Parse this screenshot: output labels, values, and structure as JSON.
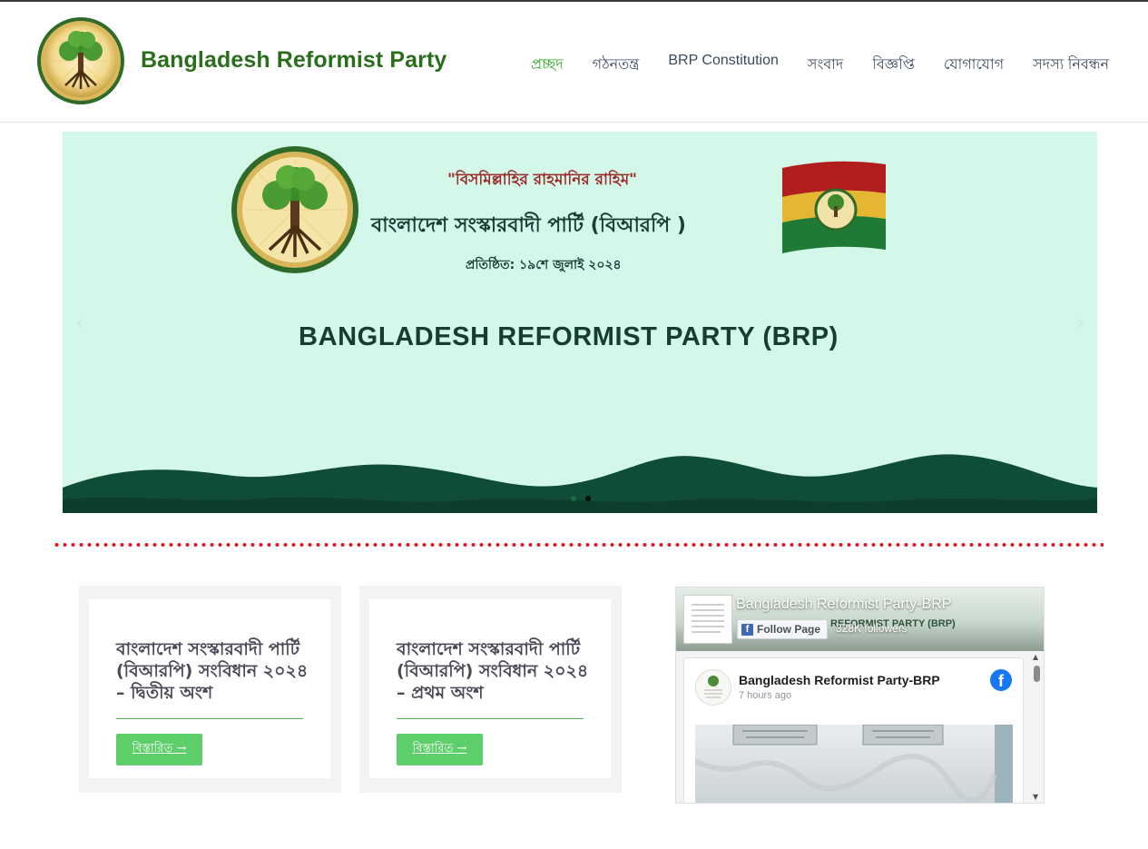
{
  "header": {
    "site_title": "Bangladesh Reformist Party",
    "nav": [
      {
        "label": "প্রচ্ছদ",
        "active": true
      },
      {
        "label": "গঠনতন্ত্র",
        "active": false
      },
      {
        "label": "BRP Constitution",
        "active": false
      },
      {
        "label": "সংবাদ",
        "active": false
      },
      {
        "label": "বিজ্ঞপ্তি",
        "active": false
      },
      {
        "label": "যোগাযোগ",
        "active": false
      },
      {
        "label": "সদস্য নিবন্ধন",
        "active": false
      }
    ]
  },
  "slider": {
    "bismillah": "\"বিসমিল্লাহির রাহমানির রাহিম\"",
    "party_name_bn": "বাংলাদেশ সংস্কারবাদী পার্টি (বিআরপি )",
    "founded": "প্রতিষ্ঠিত: ১৯শে জুলাই ২০২৪",
    "party_name_en": "BANGLADESH REFORMIST PARTY (BRP)",
    "prev_icon": "chevron-left-icon",
    "next_icon": "chevron-right-icon",
    "active_slide": 2,
    "slide_count": 2
  },
  "cards": [
    {
      "title": "বাংলাদেশ সংস্কারবাদী পার্টি (বিআরপি) সংবিধান ২০২৪ – দ্বিতীয় অংশ",
      "button": "বিস্তারিত →"
    },
    {
      "title": "বাংলাদেশ সংস্কারবাদী পার্টি (বিআরপি) সংবিধান ২০২৪ – প্রথম অংশ",
      "button": "বিস্তারিত →"
    }
  ],
  "facebook": {
    "page_name": "Bangladesh Reformist Party-BRP",
    "follow_label": "Follow Page",
    "followers": "328K followers",
    "cover_text": "REFORMIST PARTY (BRP)",
    "post_author": "Bangladesh Reformist Party-BRP",
    "post_time": "7 hours ago",
    "icon": "facebook-icon"
  },
  "colors": {
    "brand_green": "#2a6e1d",
    "nav_active": "#23a41a",
    "slider_bg": "#d3f7e8",
    "wave_dark": "#0f4d36",
    "dot_red": "#e0141c",
    "button_green": "#5dce6a"
  }
}
